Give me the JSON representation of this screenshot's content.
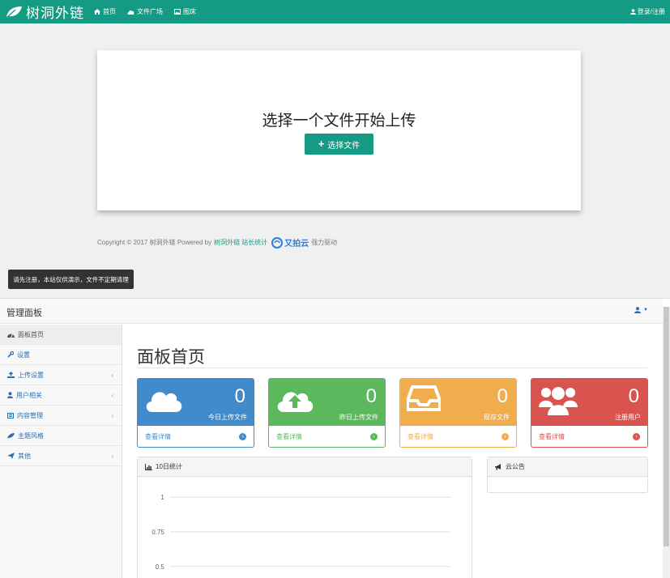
{
  "navbar": {
    "brand": "树洞外链",
    "links": [
      {
        "label": "首页",
        "icon": "home-icon"
      },
      {
        "label": "文件广场",
        "icon": "cloud-icon"
      },
      {
        "label": "图床",
        "icon": "image-icon"
      }
    ],
    "login": "登录/注册"
  },
  "upload": {
    "title": "选择一个文件开始上传",
    "button": "选择文件"
  },
  "copyright": {
    "prefix": "Copyright © 2017 树洞外链 Powered by",
    "powered": "树洞外链",
    "stats": "站长统计",
    "cdn": "又拍云",
    "suffix": "强力驱动"
  },
  "toast": "请先注册，本站仅供演示，文件不定期清理",
  "admin": {
    "title": "管理面板",
    "sidebar": [
      {
        "label": "面板首页",
        "icon": "dashboard-icon",
        "active": true,
        "caret": false
      },
      {
        "label": "设置",
        "icon": "wrench-icon",
        "active": false,
        "caret": false
      },
      {
        "label": "上传设置",
        "icon": "upload-icon",
        "active": false,
        "caret": true
      },
      {
        "label": "用户相关",
        "icon": "user-icon",
        "active": false,
        "caret": true
      },
      {
        "label": "内容管理",
        "icon": "list-icon",
        "active": false,
        "caret": true
      },
      {
        "label": "主题风格",
        "icon": "leaf-icon",
        "active": false,
        "caret": false
      },
      {
        "label": "其他",
        "icon": "send-icon",
        "active": false,
        "caret": true
      }
    ],
    "page_title": "面板首页",
    "stats": [
      {
        "value": "0",
        "label": "今日上传文件",
        "link": "查看详情",
        "color": "#428bca",
        "icon": "cloud-icon"
      },
      {
        "value": "0",
        "label": "昨日上传文件",
        "link": "查看详情",
        "color": "#5cb85c",
        "icon": "cloud-upload-icon"
      },
      {
        "value": "0",
        "label": "现存文件",
        "link": "查看详情",
        "color": "#f0ad4e",
        "icon": "inbox-icon"
      },
      {
        "value": "0",
        "label": "注册用户",
        "link": "查看详情",
        "color": "#d9534f",
        "icon": "users-icon"
      }
    ],
    "stats_panel_title": "10日统计",
    "notice_panel_title": "云公告"
  },
  "chart_data": {
    "type": "line",
    "title": "10日统计",
    "ytick_labels": [
      "1",
      "0.75",
      "0.5"
    ],
    "series": []
  }
}
